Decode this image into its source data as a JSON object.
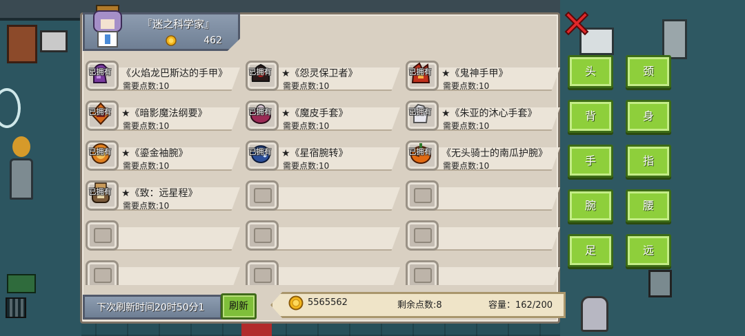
{
  "owner": {
    "name": "『迷之科学家』",
    "gold": "462"
  },
  "items": [
    {
      "owned_label": "已拥有",
      "name": "《火焰龙巴斯达的手甲》",
      "cost": "需要点数:10",
      "icon": "dragon-gauntlet-icon",
      "color": "#7a3aa0"
    },
    {
      "owned_label": "已拥有",
      "name": "★《怨灵保卫者》",
      "cost": "需要点数:10",
      "icon": "wraith-guard-icon",
      "color": "#b51d1d"
    },
    {
      "owned_label": "已拥有",
      "name": "★《鬼神手甲》",
      "cost": "需要点数:10",
      "icon": "demon-gauntlet-icon",
      "color": "#c0301c"
    },
    {
      "owned_label": "已拥有",
      "name": "★《暗影魔法纲要》",
      "cost": "需要点数:10",
      "icon": "shadow-tome-icon",
      "color": "#d8691a"
    },
    {
      "owned_label": "已拥有",
      "name": "★《魔皮手套》",
      "cost": "需要点数:10",
      "icon": "demon-glove-icon",
      "color": "#9b2a55"
    },
    {
      "owned_label": "已拥有",
      "name": "★《朱亚的沐心手套》",
      "cost": "需要点数:10",
      "icon": "zhuya-glove-icon",
      "color": "#e8e8f0"
    },
    {
      "owned_label": "已拥有",
      "name": "★《鎏金袖腕》",
      "cost": "需要点数:10",
      "icon": "gilded-bracer-icon",
      "color": "#e0801f"
    },
    {
      "owned_label": "已拥有",
      "name": "★《星宿腕转》",
      "cost": "需要点数:10",
      "icon": "star-bracer-icon",
      "color": "#2b4f9a"
    },
    {
      "owned_label": "已拥有",
      "name": "《无头骑士的南瓜护腕》",
      "cost": "需要点数:10",
      "icon": "pumpkin-bracer-icon",
      "color": "#e26a12"
    },
    {
      "owned_label": "已拥有",
      "name": "★《致：远星程》",
      "cost": "需要点数:10",
      "icon": "distant-star-icon",
      "color": "#7a5a3a"
    }
  ],
  "bottom": {
    "refresh_time": "下次刷新时间20时50分1",
    "refresh_label": "刷新",
    "gold": "5565562",
    "points": "剩余点数:8",
    "capacity": "容量：162/200"
  },
  "categories": [
    "头",
    "颈",
    "背",
    "身",
    "手",
    "指",
    "腕",
    "腰",
    "足",
    "远"
  ],
  "colors": {
    "panel": "#d9d0c2",
    "button_green": "#8ecf3b",
    "coin": "#f2b51c"
  }
}
